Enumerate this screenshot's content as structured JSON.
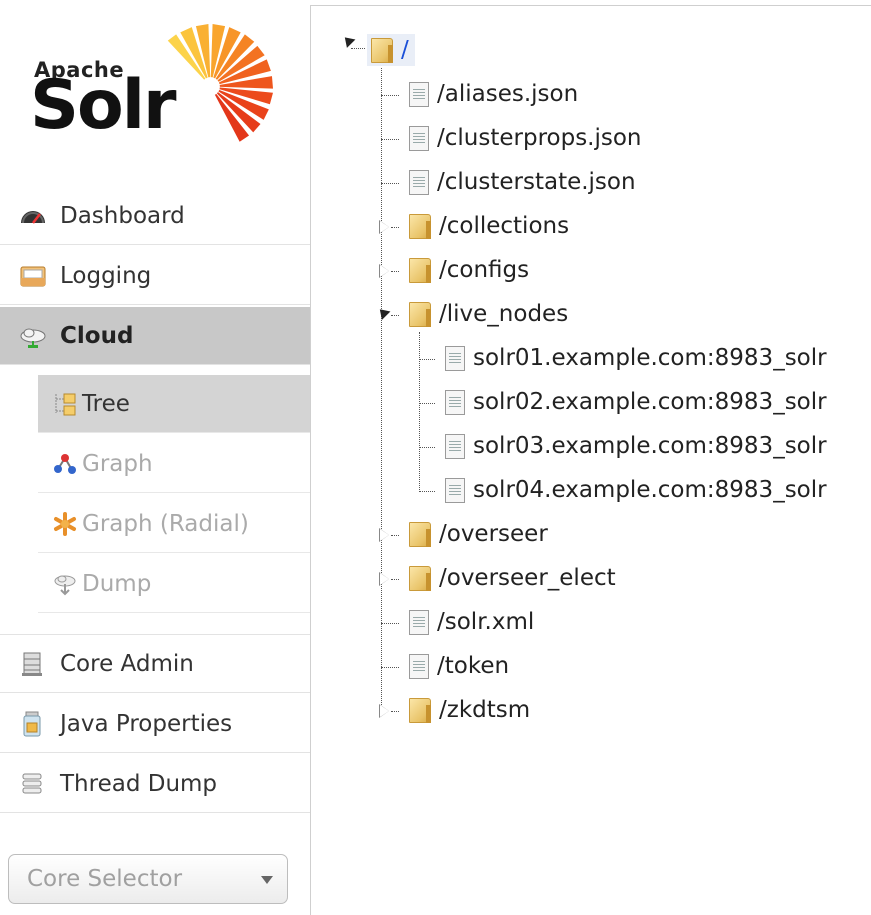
{
  "logo": {
    "brand_small": "Apache",
    "brand_big": "Solr"
  },
  "nav": {
    "dashboard": "Dashboard",
    "logging": "Logging",
    "cloud": "Cloud",
    "cloud_sub": {
      "tree": "Tree",
      "graph": "Graph",
      "graph_radial": "Graph (Radial)",
      "dump": "Dump"
    },
    "core_admin": "Core Admin",
    "java_properties": "Java Properties",
    "thread_dump": "Thread Dump"
  },
  "core_selector": {
    "placeholder": "Core Selector"
  },
  "tree": {
    "root": "/",
    "children": [
      {
        "label": "/aliases.json",
        "type": "file"
      },
      {
        "label": "/clusterprops.json",
        "type": "file"
      },
      {
        "label": "/clusterstate.json",
        "type": "file"
      },
      {
        "label": "/collections",
        "type": "folder",
        "expanded": false
      },
      {
        "label": "/configs",
        "type": "folder",
        "expanded": false
      },
      {
        "label": "/live_nodes",
        "type": "folder",
        "expanded": true,
        "children": [
          {
            "label": "solr01.example.com:8983_solr",
            "type": "file"
          },
          {
            "label": "solr02.example.com:8983_solr",
            "type": "file"
          },
          {
            "label": "solr03.example.com:8983_solr",
            "type": "file"
          },
          {
            "label": "solr04.example.com:8983_solr",
            "type": "file"
          }
        ]
      },
      {
        "label": "/overseer",
        "type": "folder",
        "expanded": false
      },
      {
        "label": "/overseer_elect",
        "type": "folder",
        "expanded": false
      },
      {
        "label": "/solr.xml",
        "type": "file"
      },
      {
        "label": "/token",
        "type": "file"
      },
      {
        "label": "/zkdtsm",
        "type": "folder",
        "expanded": false
      }
    ]
  },
  "colors": {
    "active_nav": "#c8c8c8",
    "active_sub": "#d4d4d4",
    "root_link": "#1a4fd8",
    "disabled_text": "#aaaaaa"
  }
}
